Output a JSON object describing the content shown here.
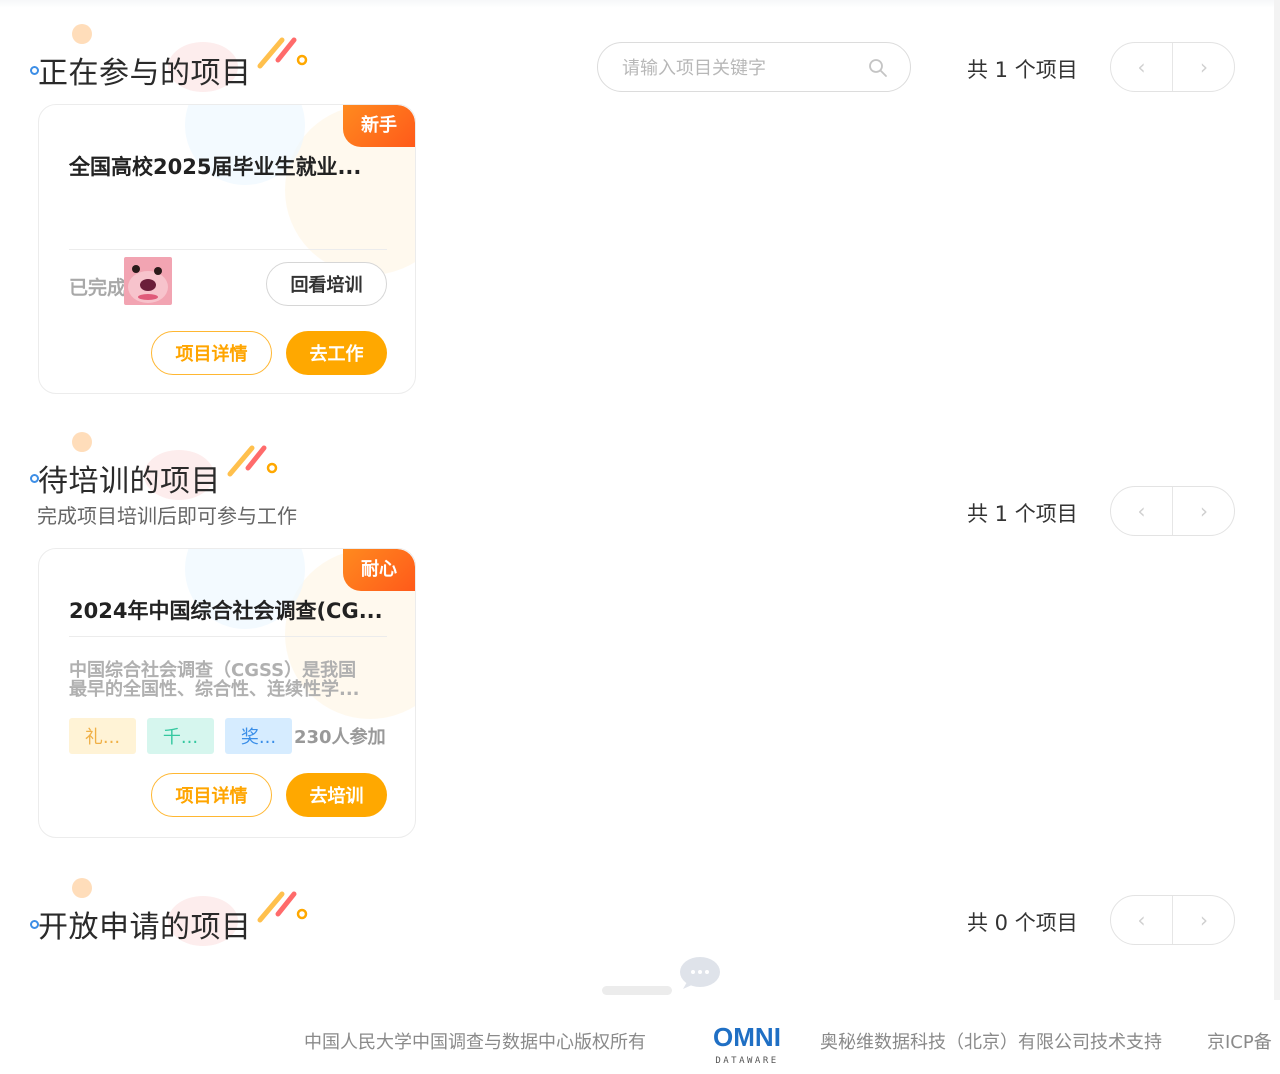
{
  "search": {
    "placeholder": "请输入项目关键字"
  },
  "participating": {
    "title": "正在参与的项目",
    "count_text": "共 1 个项目",
    "cards": [
      {
        "badge": "新手",
        "title": "全国高校2025届毕业生就业...",
        "status": "已完成",
        "review_button": "回看培训",
        "detail_button": "项目详情",
        "action_button": "去工作"
      }
    ]
  },
  "pending": {
    "title": "待培训的项目",
    "subtitle": "完成项目培训后即可参与工作",
    "count_text": "共 1 个项目",
    "cards": [
      {
        "badge": "耐心",
        "title": "2024年中国综合社会调查(CG...",
        "desc_line1": "中国综合社会调查（CGSS）是我国",
        "desc_line2": "最早的全国性、综合性、连续性学...",
        "tags": [
          "礼...",
          "千...",
          "奖..."
        ],
        "participants": "230人参加",
        "detail_button": "项目详情",
        "action_button": "去培训"
      }
    ]
  },
  "open": {
    "title": "开放申请的项目",
    "count_text": "共 0 个项目"
  },
  "pager": {
    "prev_icon": "chevron-left-icon",
    "next_icon": "chevron-right-icon"
  },
  "footer": {
    "copyright": "中国人民大学中国调查与数据中心版权所有",
    "logo_text": "OMNI",
    "logo_sub": "DATAWARE",
    "support": "奥秘维数据科技（北京）有限公司技术支持",
    "icp": "京ICP备"
  },
  "colors": {
    "accent": "#ffa800",
    "badge": "#ff6a1a",
    "link_blue": "#3d8ee6"
  }
}
